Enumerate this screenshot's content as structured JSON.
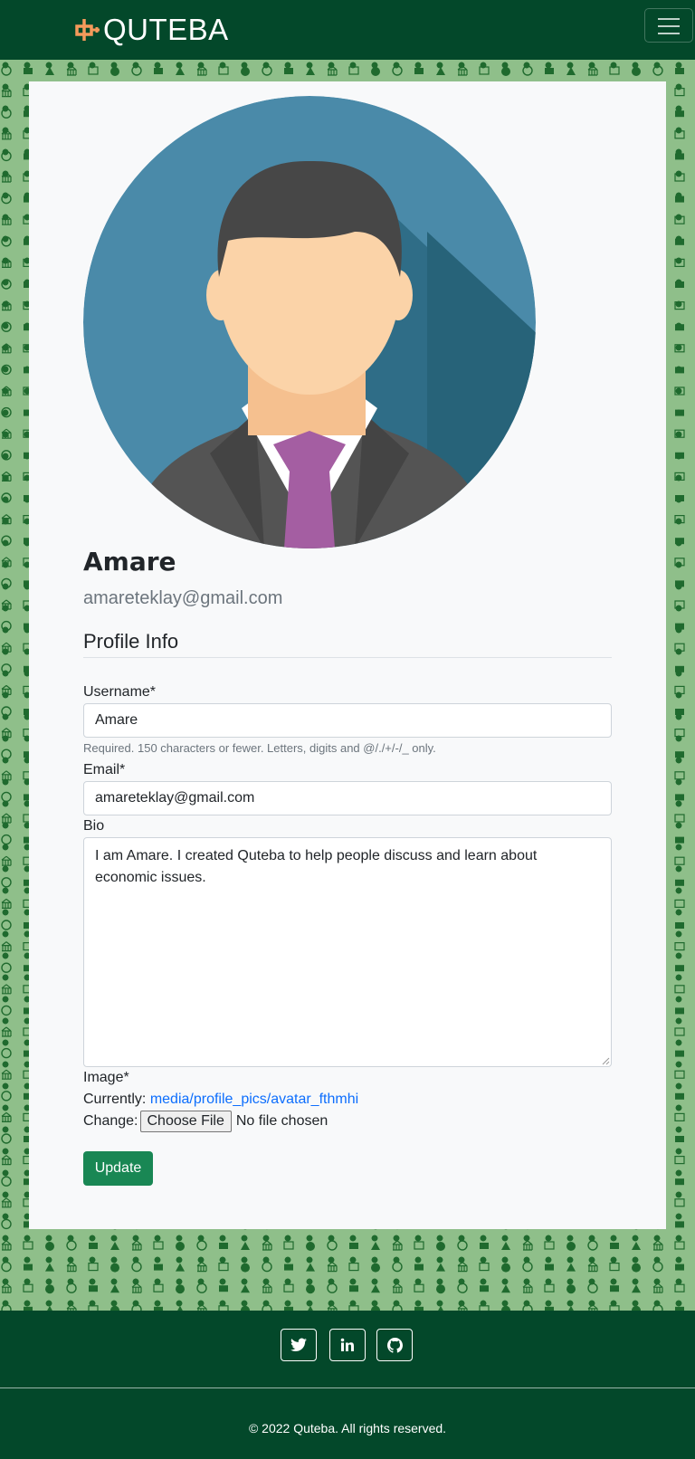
{
  "navbar": {
    "brand": "QUTEBA",
    "brand_icon": "quteba-logo-icon",
    "menu_icon": "hamburger-icon"
  },
  "profile": {
    "name": "Amare",
    "email": "amareteklay@gmail.com"
  },
  "form": {
    "section_title": "Profile Info",
    "username_label": "Username*",
    "username_value": "Amare",
    "username_help": "Required. 150 characters or fewer. Letters, digits and @/./+/-/_ only.",
    "email_label": "Email*",
    "email_value": "amareteklay@gmail.com",
    "bio_label": "Bio",
    "bio_value": "I am Amare. I created Quteba to help people discuss and learn about economic issues.",
    "image_label": "Image*",
    "currently_label": "Currently:",
    "current_image": "media/profile_pics/avatar_fthmhi",
    "change_label": "Change:",
    "choose_file": "Choose File",
    "no_file": "No file chosen",
    "update_button": "Update"
  },
  "footer": {
    "social": [
      "twitter-icon",
      "linkedin-icon",
      "github-icon"
    ],
    "copyright": "2022 Quteba. All rights reserved."
  },
  "colors": {
    "navbar": "#03482a",
    "pattern_bg": "#8fbf8a",
    "pattern_icons": "#1f6a2e",
    "accent": "#f59a5b",
    "update_button": "#198754",
    "link": "#0d6efd"
  }
}
